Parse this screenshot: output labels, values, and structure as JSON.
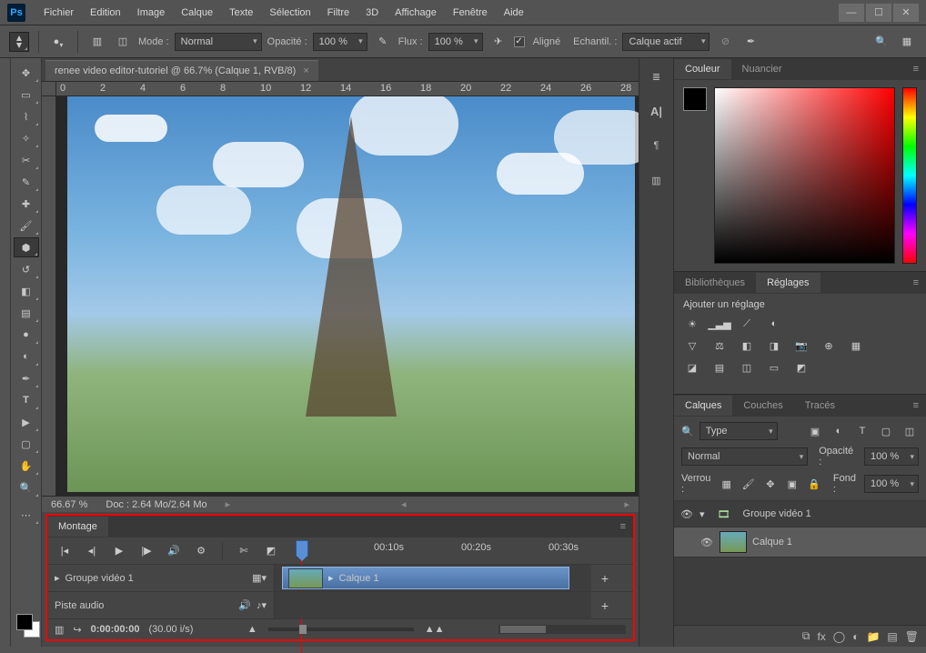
{
  "app": {
    "logo": "Ps"
  },
  "menu": [
    "Fichier",
    "Edition",
    "Image",
    "Calque",
    "Texte",
    "Sélection",
    "Filtre",
    "3D",
    "Affichage",
    "Fenêtre",
    "Aide"
  ],
  "options_bar": {
    "mode_label": "Mode :",
    "mode_value": "Normal",
    "opacity_label": "Opacité :",
    "opacity_value": "100 %",
    "flux_label": "Flux :",
    "flux_value": "100 %",
    "aligne_label": "Aligné",
    "echantil_label": "Echantil. :",
    "echantil_value": "Calque actif"
  },
  "document": {
    "tab_title": "renee video editor-tutoriel @ 66.7% (Calque 1, RVB/8)",
    "zoom": "66.67 %",
    "doc_size": "Doc : 2.64 Mo/2.64 Mo"
  },
  "ruler_marks": [
    "0",
    "2",
    "4",
    "6",
    "8",
    "10",
    "12",
    "14",
    "16",
    "18",
    "20",
    "22",
    "24",
    "26",
    "28"
  ],
  "timeline": {
    "panel_title": "Montage",
    "time_marks": [
      "00:10s",
      "00:20s",
      "00:30s"
    ],
    "group_track": "Groupe vidéo 1",
    "clip_name": "Calque 1",
    "audio_track": "Piste audio",
    "current_time": "0:00:00:00",
    "fps": "(30.00 i/s)"
  },
  "panels": {
    "couleur_tab": "Couleur",
    "nuancier_tab": "Nuancier",
    "biblio_tab": "Bibliothèques",
    "reglages_tab": "Réglages",
    "reglages_hint": "Ajouter un réglage",
    "calques_tab": "Calques",
    "couches_tab": "Couches",
    "traces_tab": "Tracés"
  },
  "layers": {
    "filter_type": "Type",
    "blend_mode": "Normal",
    "opacity_label": "Opacité :",
    "opacity_value": "100 %",
    "lock_label": "Verrou :",
    "fill_label": "Fond :",
    "fill_value": "100 %",
    "items": [
      {
        "name": "Groupe vidéo 1",
        "type": "group"
      },
      {
        "name": "Calque 1",
        "type": "layer"
      }
    ]
  }
}
